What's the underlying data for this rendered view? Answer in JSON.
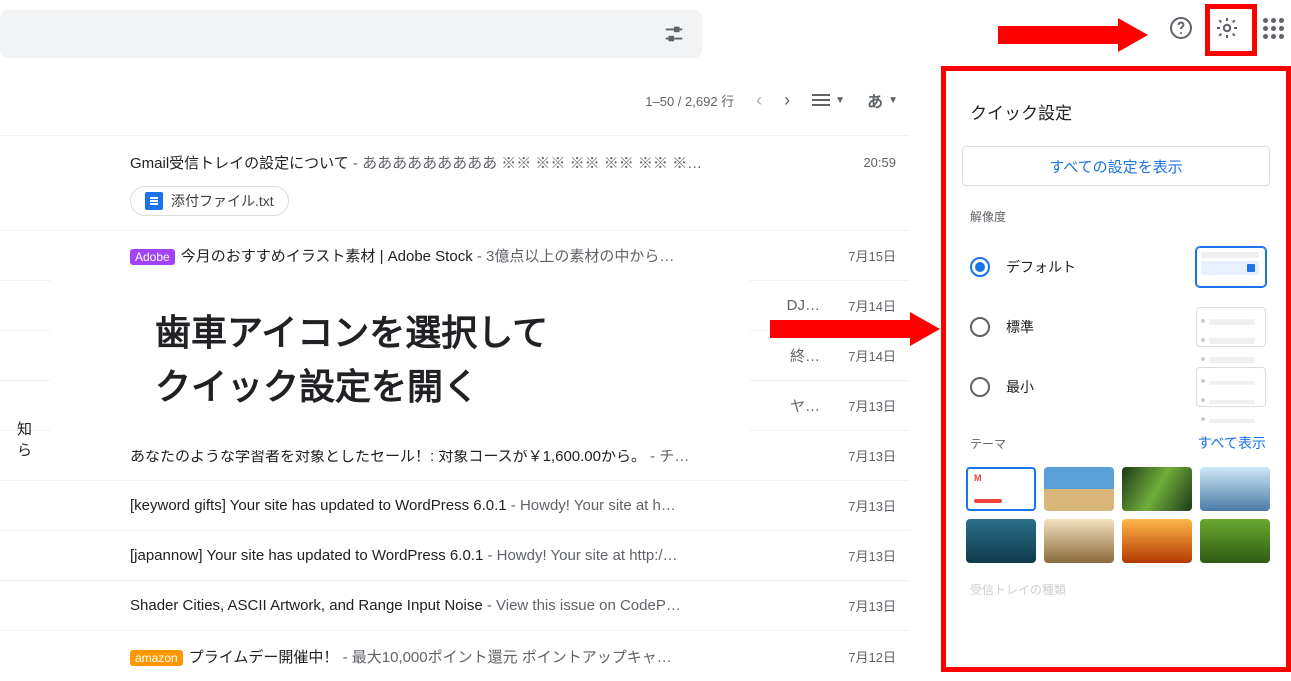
{
  "toolbar": {
    "row_counter": "1–50 / 2,692 行",
    "ime": "あ"
  },
  "quick_settings": {
    "title": "クイック設定",
    "all_settings": "すべての設定を表示",
    "density_label": "解像度",
    "density_options": [
      "デフォルト",
      "標準",
      "最小"
    ],
    "theme_label": "テーマ",
    "theme_view_all": "すべて表示",
    "bottom_cutoff": "受信トレイの種類"
  },
  "instruction": {
    "line1": "歯車アイコンを選択して",
    "line2": "クイック設定を開く"
  },
  "truncated_left": "知ら",
  "emails": [
    {
      "subject": "Gmail受信トレイの設定について",
      "snippet": " - あああああああああ ※※ ※※ ※※ ※※ ※※ ※…",
      "date": "20:59",
      "attachment": "添付ファイル.txt"
    },
    {
      "badge": "Adobe",
      "badge_class": "badge-purple",
      "subject": "今月のおすすめイラスト素材 | Adobe Stock",
      "snippet": " - 3億点以上の素材の中から…",
      "date": "7月15日"
    },
    {
      "subject": "",
      "snippet": "DJ…",
      "date": "7月14日"
    },
    {
      "subject": "",
      "snippet": "終…",
      "date": "7月14日"
    },
    {
      "subject": "",
      "snippet": "ヤ…",
      "date": "7月13日"
    },
    {
      "subject": "あなたのような学習者を対象としたセール！: 対象コースが￥1,600.00から。",
      "snippet": " - チ…",
      "date": "7月13日"
    },
    {
      "subject": "[keyword gifts] Your site has updated to WordPress 6.0.1",
      "snippet": " - Howdy! Your site at h…",
      "date": "7月13日"
    },
    {
      "subject": "[japannow] Your site has updated to WordPress 6.0.1",
      "snippet": " - Howdy! Your site at http:/…",
      "date": "7月13日"
    },
    {
      "subject": "Shader Cities, ASCII Artwork, and Range Input Noise",
      "snippet": " - View this issue on CodeP…",
      "date": "7月13日"
    },
    {
      "badge": "amazon",
      "badge_class": "badge-orange",
      "subject": "プライムデー開催中！",
      "snippet": " - 最大10,000ポイント還元 ポイントアップキャ…",
      "date": "7月12日"
    }
  ]
}
